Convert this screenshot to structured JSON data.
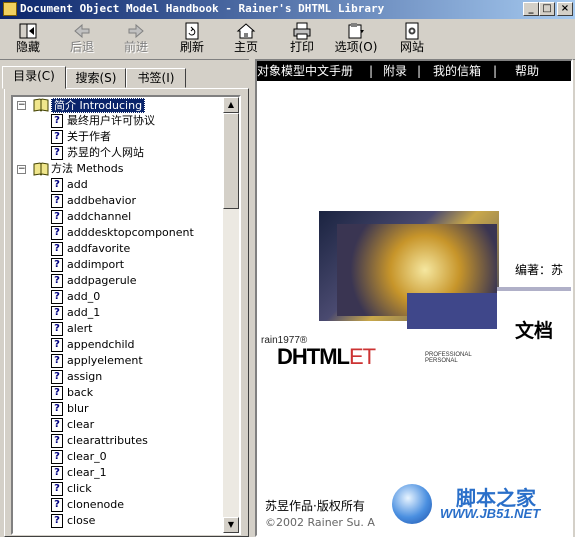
{
  "window": {
    "title": "Document Object Model Handbook - Rainer's DHTML Library",
    "minimize": "_",
    "maximize": "□",
    "close": "×"
  },
  "toolbar": {
    "hide": "隐藏",
    "back": "后退",
    "forward": "前进",
    "refresh": "刷新",
    "home": "主页",
    "print": "打印",
    "options": "选项(O)",
    "website": "网站"
  },
  "tabs": {
    "contents": "目录(C)",
    "search": "搜索(S)",
    "bookmarks": "书签(I)"
  },
  "tree": {
    "expand_open": "−",
    "intro": "简介 Introducing",
    "intro_items": [
      "最终用户许可协议",
      "关于作者",
      "苏昱的个人网站"
    ],
    "methods": "方法 Methods",
    "method_items": [
      "add",
      "addbehavior",
      "addchannel",
      "adddesktopcomponent",
      "addfavorite",
      "addimport",
      "addpagerule",
      "add_0",
      "add_1",
      "alert",
      "appendchild",
      "applyelement",
      "assign",
      "back",
      "blur",
      "clear",
      "clearattributes",
      "clear_0",
      "clear_1",
      "click",
      "clonenode",
      "close"
    ],
    "doc_glyph": "?"
  },
  "content": {
    "nav": [
      "对象模型中文手册",
      "|",
      "附录",
      "|",
      "我的信箱",
      "|",
      "帮助"
    ],
    "editor": "编著：苏",
    "doc_title": "文档",
    "rain": "rain1977®",
    "logo_main": "DHTML",
    "logo_accent": "ET",
    "logo_sub": "PROFESSIONAL PERSONAL",
    "copyright": "苏昱作品·版权所有",
    "copyright2": "©2002 Rainer Su. A"
  },
  "watermark": {
    "title": "脚本之家",
    "url": "WWW.JB51.NET"
  },
  "colors": {
    "titlebar_start": "#0a246a",
    "titlebar_end": "#a6caf0",
    "selection": "#0a246a",
    "navbar": "#000000"
  }
}
